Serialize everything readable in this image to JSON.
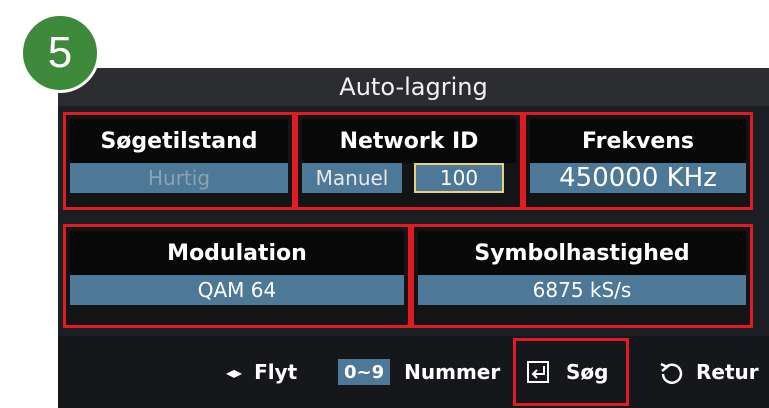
{
  "step": "5",
  "title": "Auto-lagring",
  "search_mode": {
    "label": "Søgetilstand",
    "value": "Hurtig"
  },
  "network_id": {
    "label": "Network ID",
    "mode": "Manuel",
    "value": "100"
  },
  "frequency": {
    "label": "Frekvens",
    "value": "450000 KHz"
  },
  "modulation": {
    "label": "Modulation",
    "value": "QAM 64"
  },
  "symbol_rate": {
    "label": "Symbolhastighed",
    "value": "6875 kS/s"
  },
  "hints": {
    "move": "Flyt",
    "number_key": "0~9",
    "number": "Nummer",
    "search": "Søg",
    "back": "Retur"
  },
  "colors": {
    "highlight": "#e01b24",
    "field": "#4d7897",
    "badge": "#3d8b3a",
    "focus": "#e9d37a"
  }
}
